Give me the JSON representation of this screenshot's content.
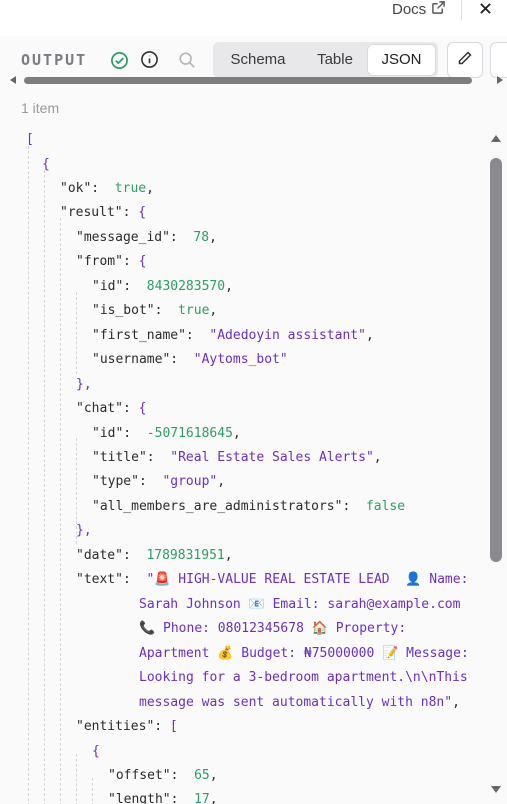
{
  "topbar": {
    "docs_label": "Docs"
  },
  "panel": {
    "output_label": "OUTPUT",
    "tabs": [
      "Schema",
      "Table",
      "JSON"
    ],
    "active_tab": "JSON",
    "item_count": "1 item"
  },
  "json_lines": [
    "[",
    "{",
    "\"ok\":",
    "true",
    ",",
    "\"result\":",
    "{",
    "\"message_id\":",
    "78",
    ",",
    "\"from\":",
    "{",
    "\"id\":",
    "8430283570",
    ",",
    "\"is_bot\":",
    "true",
    ",",
    "\"first_name\":",
    "\"Adedoyin assistant\"",
    ",",
    "\"username\":",
    "\"Aytoms_bot\"",
    "},",
    "\"chat\":",
    "{",
    "\"id\":",
    "-5071618645",
    ",",
    "\"title\":",
    "\"Real Estate Sales Alerts\"",
    ",",
    "\"type\":",
    "\"group\"",
    ",",
    "\"all_members_are_administrators\":",
    "false",
    "},",
    "\"date\":",
    "1789831951",
    ",",
    "\"text\":",
    "\"🚨 HIGH-VALUE REAL ESTATE LEAD  👤 Name:",
    "Sarah Johnson 📧 Email: sarah@example.com",
    "📞 Phone: 08012345678 🏠 Property:",
    "Apartment 💰 Budget: ₦75000000 📝 Message:",
    "Looking for a 3-bedroom apartment.\\n\\nThis",
    "message was sent automatically with n8n\"",
    ",",
    "\"entities\":",
    "[",
    "{",
    "\"offset\":",
    "65",
    ",",
    "\"length\":",
    "17",
    ","
  ],
  "icons": {
    "docs": "external-link-icon",
    "close": "close-icon",
    "status": "check-circle-icon",
    "info": "info-icon",
    "search": "search-icon",
    "edit": "pencil-icon"
  },
  "colors": {
    "string": "#6b2fbf",
    "number": "#2c9e63",
    "success": "#2c9e63"
  }
}
